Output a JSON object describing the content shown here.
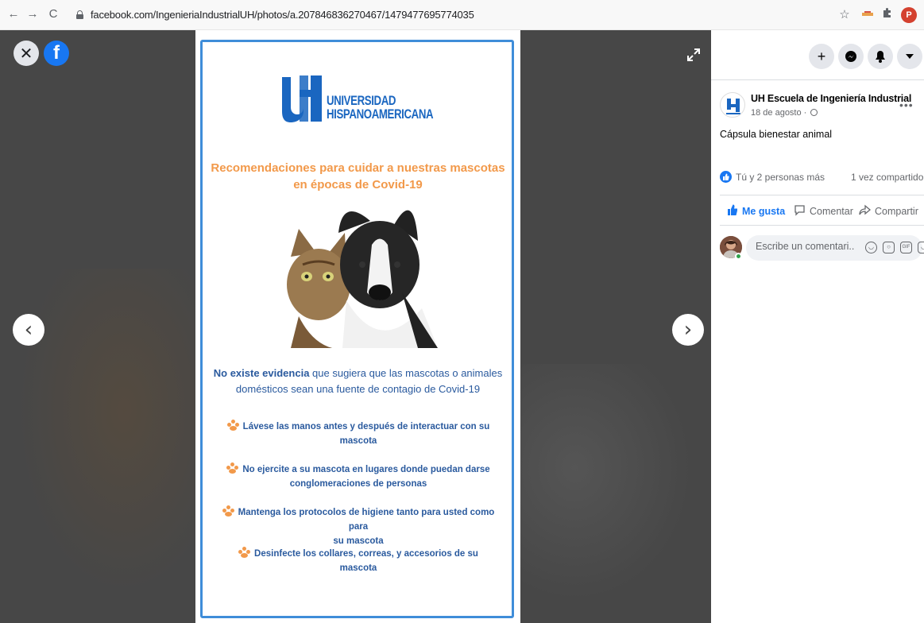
{
  "browser": {
    "back": "←",
    "forward": "→",
    "reload": "C",
    "url": "facebook.com/IngenieriaIndustrialUH/photos/a.207846836270467/1479477695774035",
    "profile_initial": "P"
  },
  "viewer": {
    "close": "✕",
    "logo": "f",
    "prev": "‹",
    "next": "›"
  },
  "poster": {
    "logo_line1": "UNIVERSIDAD",
    "logo_line2": "HISPANOAMERICANA",
    "title_line1": "Recomendaciones para cuidar a nuestras mascotas",
    "title_line2": "en épocas de Covid-19",
    "lead_bold": "No existe evidencia",
    "lead_rest": " que sugiera que las mascotas o animales domésticos sean una fuente de contagio de Covid-19",
    "tips": [
      {
        "line1": "Lávese las manos antes y después de interactuar con su",
        "line2": "mascota"
      },
      {
        "line1": "No ejercite a su mascota en lugares donde puedan darse",
        "line2": "conglomeraciones de personas"
      },
      {
        "line1": "Mantenga los protocolos de higiene tanto para usted como para",
        "line2": "su mascota"
      },
      {
        "line1": "Desinfecte los collares, correas, y accesorios de su mascota",
        "line2": ""
      }
    ]
  },
  "sidebar": {
    "page_name": "UH Escuela de Ingeniería Industrial",
    "date": "18 de agosto ·",
    "caption": "Cápsula bienestar animal",
    "reactions_text": "Tú y 2 personas más",
    "shares_text": "1 vez compartido",
    "like_label": "Me gusta",
    "comment_label": "Comentar",
    "share_label": "Compartir",
    "comment_placeholder": "Escribe un comentari..."
  },
  "colors": {
    "facebook_blue": "#1877f2",
    "poster_orange": "#f2994a",
    "poster_blue": "#2a5a9e",
    "viewer_bg": "#474747"
  }
}
